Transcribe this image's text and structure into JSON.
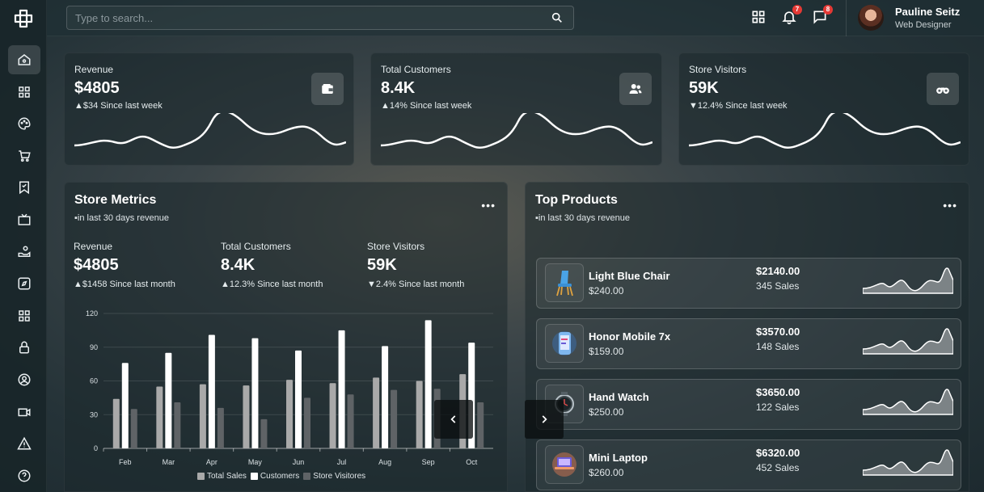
{
  "search": {
    "placeholder": "Type to search..."
  },
  "header": {
    "notifications_count": "7",
    "messages_count": "8",
    "user": {
      "name": "Pauline Seitz",
      "role": "Web Designer"
    }
  },
  "sidebar": {
    "items": [
      {
        "icon": "home-icon",
        "active": true
      },
      {
        "icon": "grid-icon"
      },
      {
        "icon": "palette-icon"
      },
      {
        "icon": "cart-icon"
      },
      {
        "icon": "bookmark-icon"
      },
      {
        "icon": "tv-icon"
      },
      {
        "icon": "hand-coin-icon"
      },
      {
        "icon": "compass-icon"
      },
      {
        "icon": "apps-icon"
      },
      {
        "icon": "lock-icon"
      },
      {
        "icon": "user-circle-icon"
      },
      {
        "icon": "video-icon"
      },
      {
        "icon": "warning-icon"
      },
      {
        "icon": "help-icon"
      }
    ]
  },
  "stats": [
    {
      "label": "Revenue",
      "value": "$4805",
      "change": "$34 Since last week",
      "trend": "up",
      "icon": "wallet-icon"
    },
    {
      "label": "Total Customers",
      "value": "8.4K",
      "change": "14% Since last week",
      "trend": "up",
      "icon": "users-icon"
    },
    {
      "label": "Store Visitors",
      "value": "59K",
      "change": "12.4% Since last week",
      "trend": "down",
      "icon": "binoculars-icon"
    }
  ],
  "store_metrics": {
    "title": "Store Metrics",
    "subtitle": "in last 30 days revenue",
    "metrics": [
      {
        "label": "Revenue",
        "value": "$4805",
        "change": "$1458 Since last month",
        "trend": "up"
      },
      {
        "label": "Total Customers",
        "value": "8.4K",
        "change": "12.3% Since last month",
        "trend": "up"
      },
      {
        "label": "Store Visitors",
        "value": "59K",
        "change": "2.4% Since last month",
        "trend": "down"
      }
    ]
  },
  "chart_data": {
    "type": "bar",
    "categories": [
      "Feb",
      "Mar",
      "Apr",
      "May",
      "Jun",
      "Jul",
      "Aug",
      "Sep",
      "Oct"
    ],
    "series": [
      {
        "name": "Total Sales",
        "color": "#a9a9a9",
        "values": [
          44,
          55,
          57,
          56,
          61,
          58,
          63,
          60,
          66
        ]
      },
      {
        "name": "Customers",
        "color": "#ffffff",
        "values": [
          76,
          85,
          101,
          98,
          87,
          105,
          91,
          114,
          94
        ]
      },
      {
        "name": "Store Visitores",
        "color": "#5f6366",
        "values": [
          35,
          41,
          36,
          26,
          45,
          48,
          52,
          53,
          41
        ]
      }
    ],
    "ylim": [
      0,
      120
    ],
    "yticks": [
      0,
      30,
      60,
      90,
      120
    ],
    "legend": "bottom-center",
    "grid": true
  },
  "top_products": {
    "title": "Top Products",
    "subtitle": "in last 30 days revenue",
    "items": [
      {
        "name": "Light Blue Chair",
        "price": "$240.00",
        "amount": "$2140.00",
        "sales": "345 Sales",
        "icon": "chair-icon"
      },
      {
        "name": "Honor Mobile 7x",
        "price": "$159.00",
        "amount": "$3570.00",
        "sales": "148 Sales",
        "icon": "mobile-icon"
      },
      {
        "name": "Hand Watch",
        "price": "$250.00",
        "amount": "$3650.00",
        "sales": "122 Sales",
        "icon": "watch-icon"
      },
      {
        "name": "Mini Laptop",
        "price": "$260.00",
        "amount": "$6320.00",
        "sales": "452 Sales",
        "icon": "laptop-icon"
      }
    ]
  }
}
